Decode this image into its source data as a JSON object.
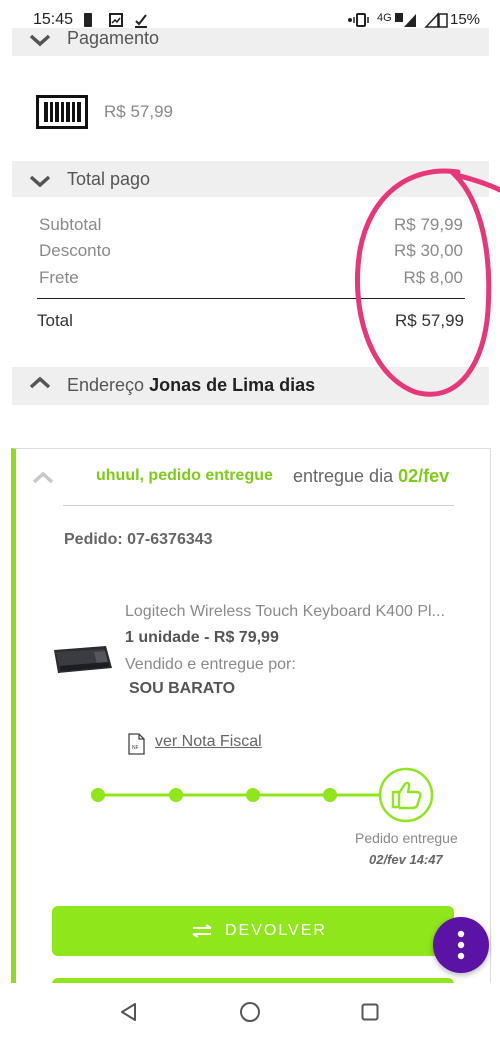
{
  "status_bar": {
    "time": "15:45",
    "network": "4G",
    "battery": "15%"
  },
  "payment": {
    "header_label": "Pagamento",
    "amount": "R$ 57,99"
  },
  "total_paid": {
    "header_label": "Total pago",
    "subtotal_label": "Subtotal",
    "subtotal_value": "R$ 79,99",
    "discount_label": "Desconto",
    "discount_value": "R$ 30,00",
    "shipping_label": "Frete",
    "shipping_value": "R$ 8,00",
    "total_label": "Total",
    "total_value": "R$ 57,99"
  },
  "address": {
    "label": "Endereço",
    "name": "Jonas de Lima dias"
  },
  "order": {
    "status_text": "uhuul, pedido entregue",
    "delivered_prefix": "entregue dia",
    "delivered_date": "02/fev",
    "order_label": "Pedido:",
    "order_number": "07-6376343",
    "product_title": "Logitech Wireless Touch Keyboard K400 Pl...",
    "quantity_price": "1 unidade - R$ 79,99",
    "sold_by_label": "Vendido e entregue por:",
    "seller": "SOU BARATO",
    "invoice_link": "ver Nota Fiscal",
    "invoice_icon_text": "NF",
    "timeline_status": "Pedido entregue",
    "timeline_time": "02/fev 14:47",
    "return_button": "DEVOLVER"
  },
  "colors": {
    "accent_green": "#8fe61a",
    "status_green": "#7ecb1a",
    "fab_purple": "#5b13a6",
    "annotation_pink": "#e8367a"
  },
  "icons": [
    "chevron-down-icon",
    "chevron-up-icon",
    "barcode-icon",
    "document-icon",
    "thumbs-up-icon",
    "swap-icon",
    "more-vertical-icon",
    "back-icon",
    "home-icon",
    "recents-icon"
  ]
}
